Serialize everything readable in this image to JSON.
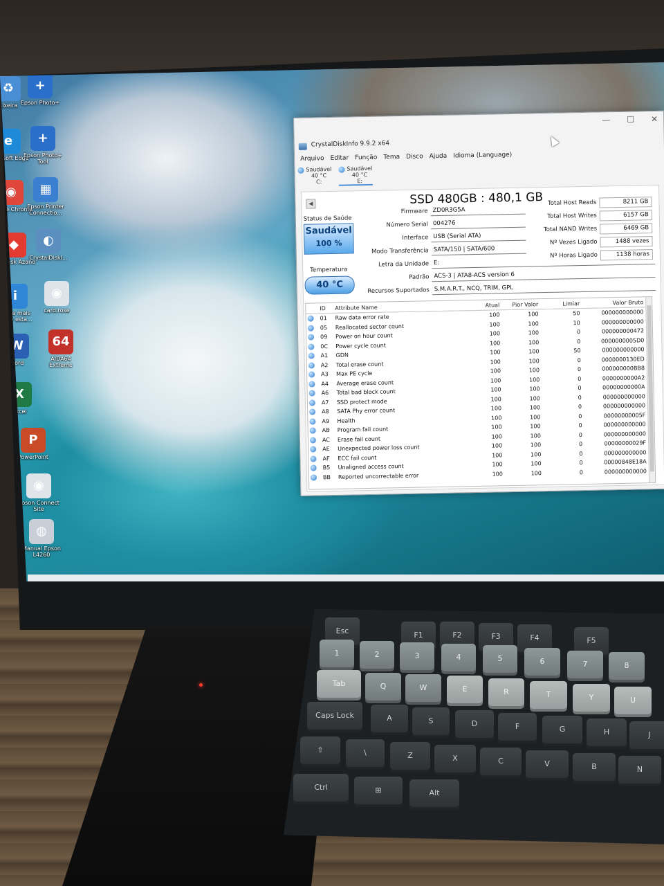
{
  "desktop": {
    "icons": [
      {
        "label": "Lixeira",
        "glyph": "♻",
        "color": "#4a8fd6"
      },
      {
        "label": "Epson Photo+",
        "glyph": "+",
        "color": "#2a6fc9"
      },
      {
        "label": "Microsoft Edge",
        "glyph": "e",
        "color": "#1f8bd8"
      },
      {
        "label": "Epson Photo+ Tool",
        "glyph": "+",
        "color": "#2a6fc9"
      },
      {
        "label": "Google Chrome",
        "glyph": "◉",
        "color": "#e0463a"
      },
      {
        "label": "Epson Printer Connectio...",
        "glyph": "▦",
        "color": "#3a7fd0"
      },
      {
        "label": "AnyDesk Azano",
        "glyph": "◆",
        "color": "#e33b2f"
      },
      {
        "label": "CrystalDiskI...",
        "glyph": "◐",
        "color": "#5a8fc0"
      },
      {
        "label": "Saiba mais sobre esta...",
        "glyph": "i",
        "color": "#2f86d6"
      },
      {
        "label": "card.rose",
        "glyph": "◉",
        "color": "#dfe4ea"
      },
      {
        "label": "Word",
        "glyph": "W",
        "color": "#2b5fb4"
      },
      {
        "label": "AIDA64 Extreme",
        "glyph": "64",
        "color": "#c2312a"
      },
      {
        "label": "Excel",
        "glyph": "X",
        "color": "#1f7a43"
      },
      {
        "label": "PowerPoint",
        "glyph": "P",
        "color": "#c94a26"
      },
      {
        "label": "Epson Connect Site",
        "glyph": "◉",
        "color": "#dfe4ea"
      },
      {
        "label": "Manual Epson L4260",
        "glyph": "◍",
        "color": "#c8cfd6"
      }
    ]
  },
  "taskbar": {
    "icons": [
      "windows-start",
      "search",
      "file-explorer",
      "edge",
      "outlook",
      "chrome",
      "app",
      "crystaldiskinfo"
    ],
    "glyphs": [
      "⊞",
      "⌕",
      "▬",
      "◉",
      "✉",
      "◉",
      "♟",
      "◧"
    ]
  },
  "window": {
    "title": "CrystalDiskInfo 9.9.2 x64",
    "controls": [
      "—",
      "☐",
      "✕"
    ],
    "menu": [
      "Arquivo",
      "Editar",
      "Função",
      "Tema",
      "Disco",
      "Ajuda",
      "Idioma (Language)"
    ],
    "drives": [
      {
        "status": "Saudável",
        "temp": "40 °C",
        "letter": "C:"
      },
      {
        "status": "Saudável",
        "temp": "40 °C",
        "letter": "E:"
      }
    ],
    "disk_title": "SSD 480GB : 480,1 GB",
    "health": {
      "label": "Status de Saúde",
      "status": "Saudável",
      "percent": "100 %"
    },
    "temperature": {
      "label": "Temperatura",
      "value": "40 °C"
    },
    "info": {
      "firmware": {
        "label": "Firmware",
        "value": "ZD0R3G5A"
      },
      "serial": {
        "label": "Número Serial",
        "value": "004276"
      },
      "interface": {
        "label": "Interface",
        "value": "USB (Serial ATA)"
      },
      "transfer": {
        "label": "Modo Transferência",
        "value": "SATA/150 | SATA/600"
      },
      "drive_letter": {
        "label": "Letra da Unidade",
        "value": "E:"
      },
      "standard": {
        "label": "Padrão",
        "value": "ACS-3 | ATA8-ACS version 6"
      },
      "features": {
        "label": "Recursos Suportados",
        "value": "S.M.A.R.T., NCQ, TRIM, GPL"
      }
    },
    "stats": {
      "host_reads": {
        "label": "Total Host Reads",
        "value": "8211 GB"
      },
      "host_writes": {
        "label": "Total Host Writes",
        "value": "6157 GB"
      },
      "nand_writes": {
        "label": "Total NAND Writes",
        "value": "6469 GB"
      },
      "power_on_count": {
        "label": "Nº Vezes Ligado",
        "value": "1488 vezes"
      },
      "power_on_hours": {
        "label": "Nº Horas Ligado",
        "value": "1138 horas"
      }
    },
    "smart": {
      "headers": [
        "ID",
        "Attribute Name",
        "Atual",
        "Pior Valor",
        "Limiar",
        "Valor Bruto"
      ],
      "rows": [
        [
          "01",
          "Raw data error rate",
          "100",
          "100",
          "50",
          "000000000000"
        ],
        [
          "05",
          "Reallocated sector count",
          "100",
          "100",
          "10",
          "000000000000"
        ],
        [
          "09",
          "Power on hour count",
          "100",
          "100",
          "0",
          "000000000472"
        ],
        [
          "0C",
          "Power cycle count",
          "100",
          "100",
          "0",
          "0000000005D0"
        ],
        [
          "A1",
          "GDN",
          "100",
          "100",
          "50",
          "000000000000"
        ],
        [
          "A2",
          "Total erase count",
          "100",
          "100",
          "0",
          "0000000130ED"
        ],
        [
          "A3",
          "Max PE cycle",
          "100",
          "100",
          "0",
          "000000000BB8"
        ],
        [
          "A4",
          "Average erase count",
          "100",
          "100",
          "0",
          "0000000000A2"
        ],
        [
          "A6",
          "Total bad block count",
          "100",
          "100",
          "0",
          "00000000000A"
        ],
        [
          "A7",
          "SSD protect mode",
          "100",
          "100",
          "0",
          "000000000000"
        ],
        [
          "A8",
          "SATA Phy error count",
          "100",
          "100",
          "0",
          "000000000000"
        ],
        [
          "A9",
          "Health",
          "100",
          "100",
          "0",
          "00000000005F"
        ],
        [
          "AB",
          "Program fail count",
          "100",
          "100",
          "0",
          "000000000000"
        ],
        [
          "AC",
          "Erase fail count",
          "100",
          "100",
          "0",
          "000000000000"
        ],
        [
          "AE",
          "Unexpected power loss count",
          "100",
          "100",
          "0",
          "00000000029F"
        ],
        [
          "AF",
          "ECC fail count",
          "100",
          "100",
          "0",
          "000000000000"
        ],
        [
          "B5",
          "Unaligned access count",
          "100",
          "100",
          "0",
          "00000848E18A"
        ],
        [
          "BB",
          "Reported uncorrectable error",
          "100",
          "100",
          "0",
          "000000000000"
        ]
      ]
    }
  },
  "keyboard": {
    "keys": [
      "Esc",
      "F1",
      "F2",
      "F3",
      "F4",
      "F5",
      "1",
      "2",
      "3",
      "4",
      "5",
      "6",
      "7",
      "8",
      "Tab",
      "Q",
      "W",
      "E",
      "R",
      "T",
      "Y",
      "U",
      "Caps Lock",
      "A",
      "S",
      "D",
      "F",
      "G",
      "H",
      "J",
      "⇧",
      "\\",
      "Z",
      "X",
      "C",
      "V",
      "B",
      "N",
      "Ctrl",
      "⊞",
      "Alt"
    ]
  }
}
